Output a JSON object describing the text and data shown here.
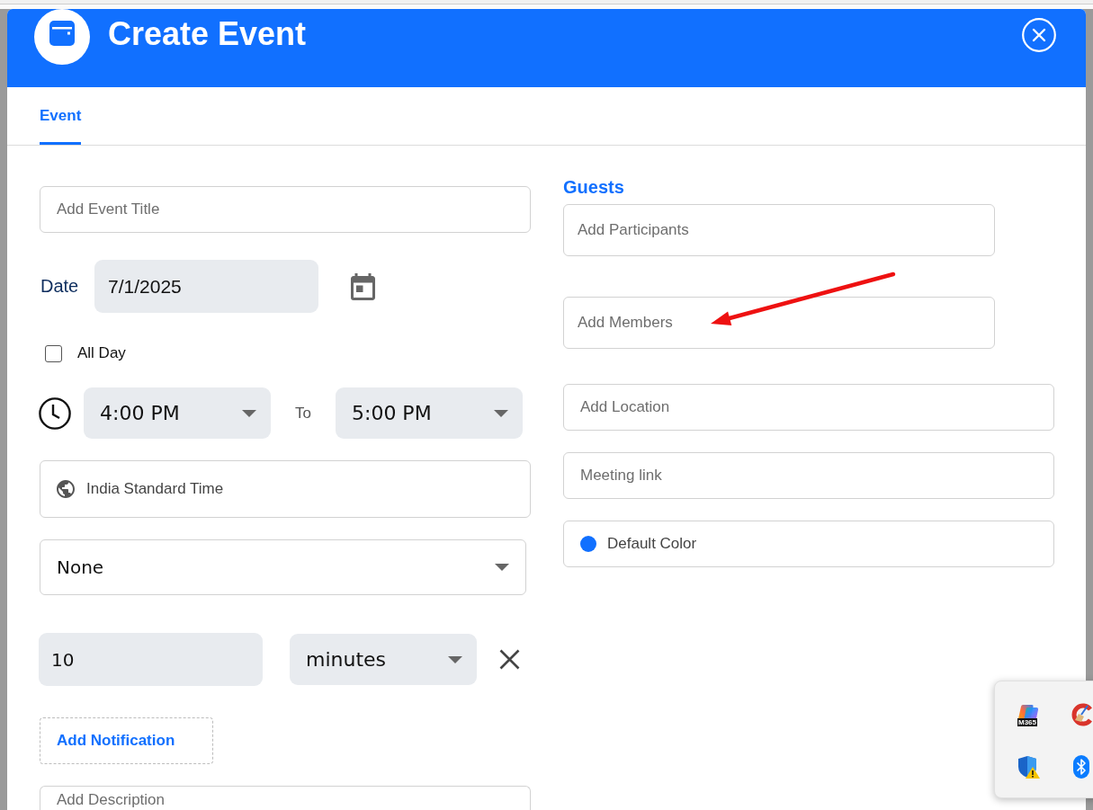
{
  "header": {
    "title": "Create Event"
  },
  "tabs": [
    {
      "label": "Event",
      "selected": true
    }
  ],
  "form": {
    "title_field": {
      "placeholder": "Add Event Title"
    },
    "date": {
      "label": "Date",
      "value": "7/1/2025"
    },
    "all_day": {
      "label": "All Day",
      "checked": false
    },
    "time": {
      "start": "4:00 PM",
      "separator": "To",
      "end": "5:00 PM"
    },
    "timezone": {
      "value": "India Standard Time"
    },
    "dropdown": {
      "value": "None"
    },
    "notification": {
      "amount": "10",
      "unit": "minutes"
    },
    "add_notification": {
      "label": "Add Notification"
    },
    "description": {
      "placeholder": "Add Description"
    }
  },
  "guests": {
    "heading": "Guests",
    "fields": [
      {
        "placeholder": "Add Participants"
      },
      {
        "placeholder": "Add Members"
      }
    ]
  },
  "details": [
    {
      "kind": "text",
      "placeholder": "Add Location"
    },
    {
      "kind": "text",
      "placeholder": "Meeting link"
    },
    {
      "kind": "color",
      "value": "Default Color",
      "color": "#1170ff"
    }
  ],
  "tray": {
    "icons": [
      {
        "kind": "app-logo",
        "badge": "M365"
      },
      {
        "kind": "cleaner"
      },
      {
        "kind": "shield-warning"
      },
      {
        "kind": "bluetooth"
      }
    ]
  }
}
